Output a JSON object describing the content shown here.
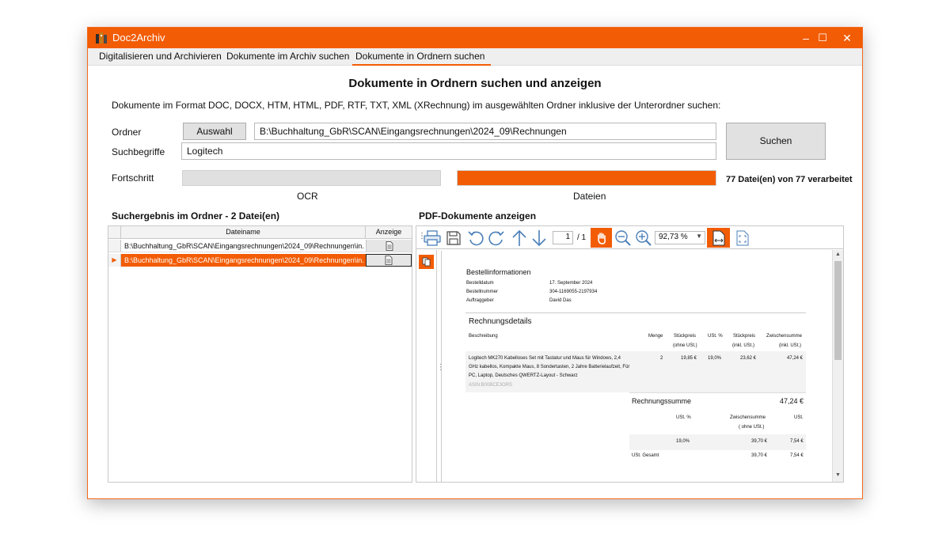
{
  "window": {
    "title": "Doc2Archiv",
    "minimize": "–",
    "maximize": "☐",
    "close": "✕"
  },
  "tabs": [
    {
      "label": "Digitalisieren und Archivieren"
    },
    {
      "label": "Dokumente im Archiv suchen"
    },
    {
      "label": "Dokumente in Ordnern suchen"
    }
  ],
  "heading": "Dokumente in Ordnern suchen und anzeigen",
  "description": "Dokumente im Format DOC, DOCX,  HTM, HTML, PDF, RTF, TXT, XML (XRechnung) im ausgewählten Ordner inklusive der Unterordner suchen:",
  "form": {
    "folder_label": "Ordner",
    "select_button": "Auswahl",
    "folder_value": "B:\\Buchhaltung_GbR\\SCAN\\Eingangsrechnungen\\2024_09\\Rechnungen",
    "search_label": "Suchbegriffe",
    "search_value": "Logitech",
    "search_button": "Suchen",
    "progress_label": "Fortschritt",
    "ocr_label": "OCR",
    "ocr_progress": 0,
    "files_label": "Dateien",
    "files_progress": 1.0,
    "progress_status": "77 Datei(en) von 77 verarbeitet"
  },
  "results": {
    "title": "Suchergebnis im Ordner - 2 Datei(en)",
    "col_filename": "Dateiname",
    "col_view": "Anzeige",
    "rows": [
      {
        "filename": "B:\\Buchhaltung_GbR\\SCAN\\Eingangsrechnungen\\2024_09\\Rechnungen\\in..."
      },
      {
        "filename": "B:\\Buchhaltung_GbR\\SCAN\\Eingangsrechnungen\\2024_09\\Rechnungen\\in..."
      }
    ]
  },
  "pdf": {
    "title": "PDF-Dokumente anzeigen",
    "page_current": "1",
    "page_total": "/ 1",
    "zoom": "92,73 %"
  },
  "invoice": {
    "order_section": "Bestellinformationen",
    "order_rows": [
      {
        "key": "Bestelldatum",
        "value": "17. September 2024"
      },
      {
        "key": "Bestellnummer",
        "value": "304-1169055-2197934"
      },
      {
        "key": "Auftraggeber",
        "value": "David Das"
      }
    ],
    "details_section": "Rechnungsdetails",
    "cols": {
      "desc": "Beschreibung",
      "qty": "Menge",
      "unit": "Stückpreis",
      "unit_sub": "(ohne USt.)",
      "vat": "USt. %",
      "unit_gross": "Stückpreis",
      "unit_gross_sub": "(inkl. USt.)",
      "subtotal": "Zwischensumme",
      "subtotal_sub": "(inkl. USt.)"
    },
    "item": {
      "line1": "Logitech MK270 Kabelloses Set mit Tastatur und Maus für Windows, 2,4",
      "line2": "GHz kabellos, Kompakte Maus, 8 Sondertasten, 2 Jahre Batterielaufzeit, Für",
      "line3": "PC, Laptop, Deutsches QWERTZ-Layout - Schwarz",
      "asin": "ASIN:B00BCE3ORS",
      "qty": "2",
      "unit": "19,85 €",
      "vat": "19,0%",
      "unit_gross": "23,62 €",
      "subtotal": "47,24 €"
    },
    "sum_label": "Rechnungssumme",
    "sum_value": "47,24 €",
    "sum_cols": {
      "vat": "USt. %",
      "subtotal": "Zwischensumme",
      "subtotal_sub": "( ohne USt.)",
      "ust": "USt."
    },
    "sum_row": {
      "vat": "19,0%",
      "subtotal": "39,70 €",
      "ust": "7,54 €"
    },
    "total_label": "USt. Gesamt",
    "total_subtotal": "39,70 €",
    "total_ust": "7,54 €"
  },
  "colors": {
    "accent": "#f25c05"
  }
}
